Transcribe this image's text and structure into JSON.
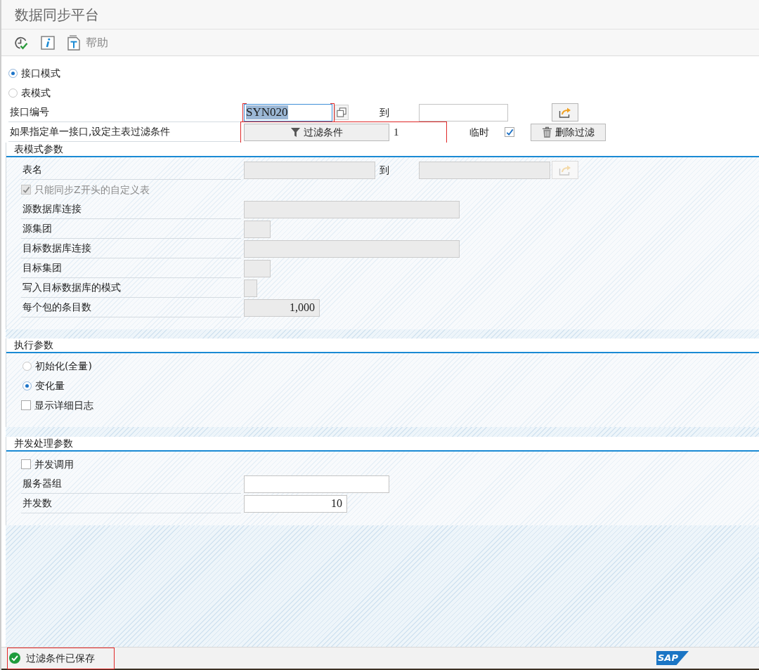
{
  "window": {
    "title": "数据同步平台"
  },
  "toolbar": {
    "items": [
      {
        "kind": "execute"
      },
      {
        "kind": "info"
      },
      {
        "kind": "help",
        "label": "帮助"
      }
    ]
  },
  "mode": [
    {
      "label": "接口模式",
      "selected": true
    },
    {
      "label": "表模式",
      "selected": false
    }
  ],
  "interface_number": {
    "label": "接口编号",
    "value": "SYN020",
    "focused": true,
    "highlighted": true,
    "to_label": "到"
  },
  "filter_row": {
    "label": "如果指定单一接口,设定主表过滤条件",
    "button": "过滤条件",
    "count": "1",
    "highlighted": true,
    "temp_label": "临时",
    "temp_checked": true,
    "delete_button": "删除过滤"
  },
  "table_mode": {
    "title": "表模式参数",
    "rows": [
      {
        "kind": "range",
        "label": "表名",
        "to_label": "到",
        "disabled": true
      },
      {
        "kind": "checkbox",
        "label": "只能同步Z开头的自定义表",
        "checked": true,
        "disabled": true
      },
      {
        "kind": "field",
        "label": "源数据库连接",
        "disabled": true
      },
      {
        "kind": "field",
        "label": "源集团",
        "disabled": true
      },
      {
        "kind": "field",
        "label": "目标数据库连接",
        "disabled": true
      },
      {
        "kind": "field",
        "label": "目标集团",
        "disabled": true
      },
      {
        "kind": "field",
        "label": "写入目标数据库的模式",
        "disabled": true
      },
      {
        "kind": "field",
        "label": "每个包的条目数",
        "value": "1,000",
        "disabled": true
      }
    ]
  },
  "exec_params": {
    "title": "执行参数",
    "rows": [
      {
        "kind": "radio",
        "label": "初始化(全量)",
        "selected": false
      },
      {
        "kind": "radio",
        "label": "变化量",
        "selected": true
      },
      {
        "kind": "checkbox",
        "label": "显示详细日志",
        "checked": false,
        "disabled": false
      }
    ]
  },
  "concurrency": {
    "title": "并发处理参数",
    "rows": [
      {
        "kind": "checkbox",
        "label": "并发调用",
        "checked": false,
        "disabled": false
      },
      {
        "kind": "field",
        "label": "服务器组",
        "disabled": false
      },
      {
        "kind": "field",
        "label": "并发数",
        "value": "10",
        "disabled": false
      }
    ]
  },
  "status_bar": {
    "message": "过滤条件已保存",
    "kind": "success",
    "highlighted": true,
    "logo": "SAP"
  }
}
